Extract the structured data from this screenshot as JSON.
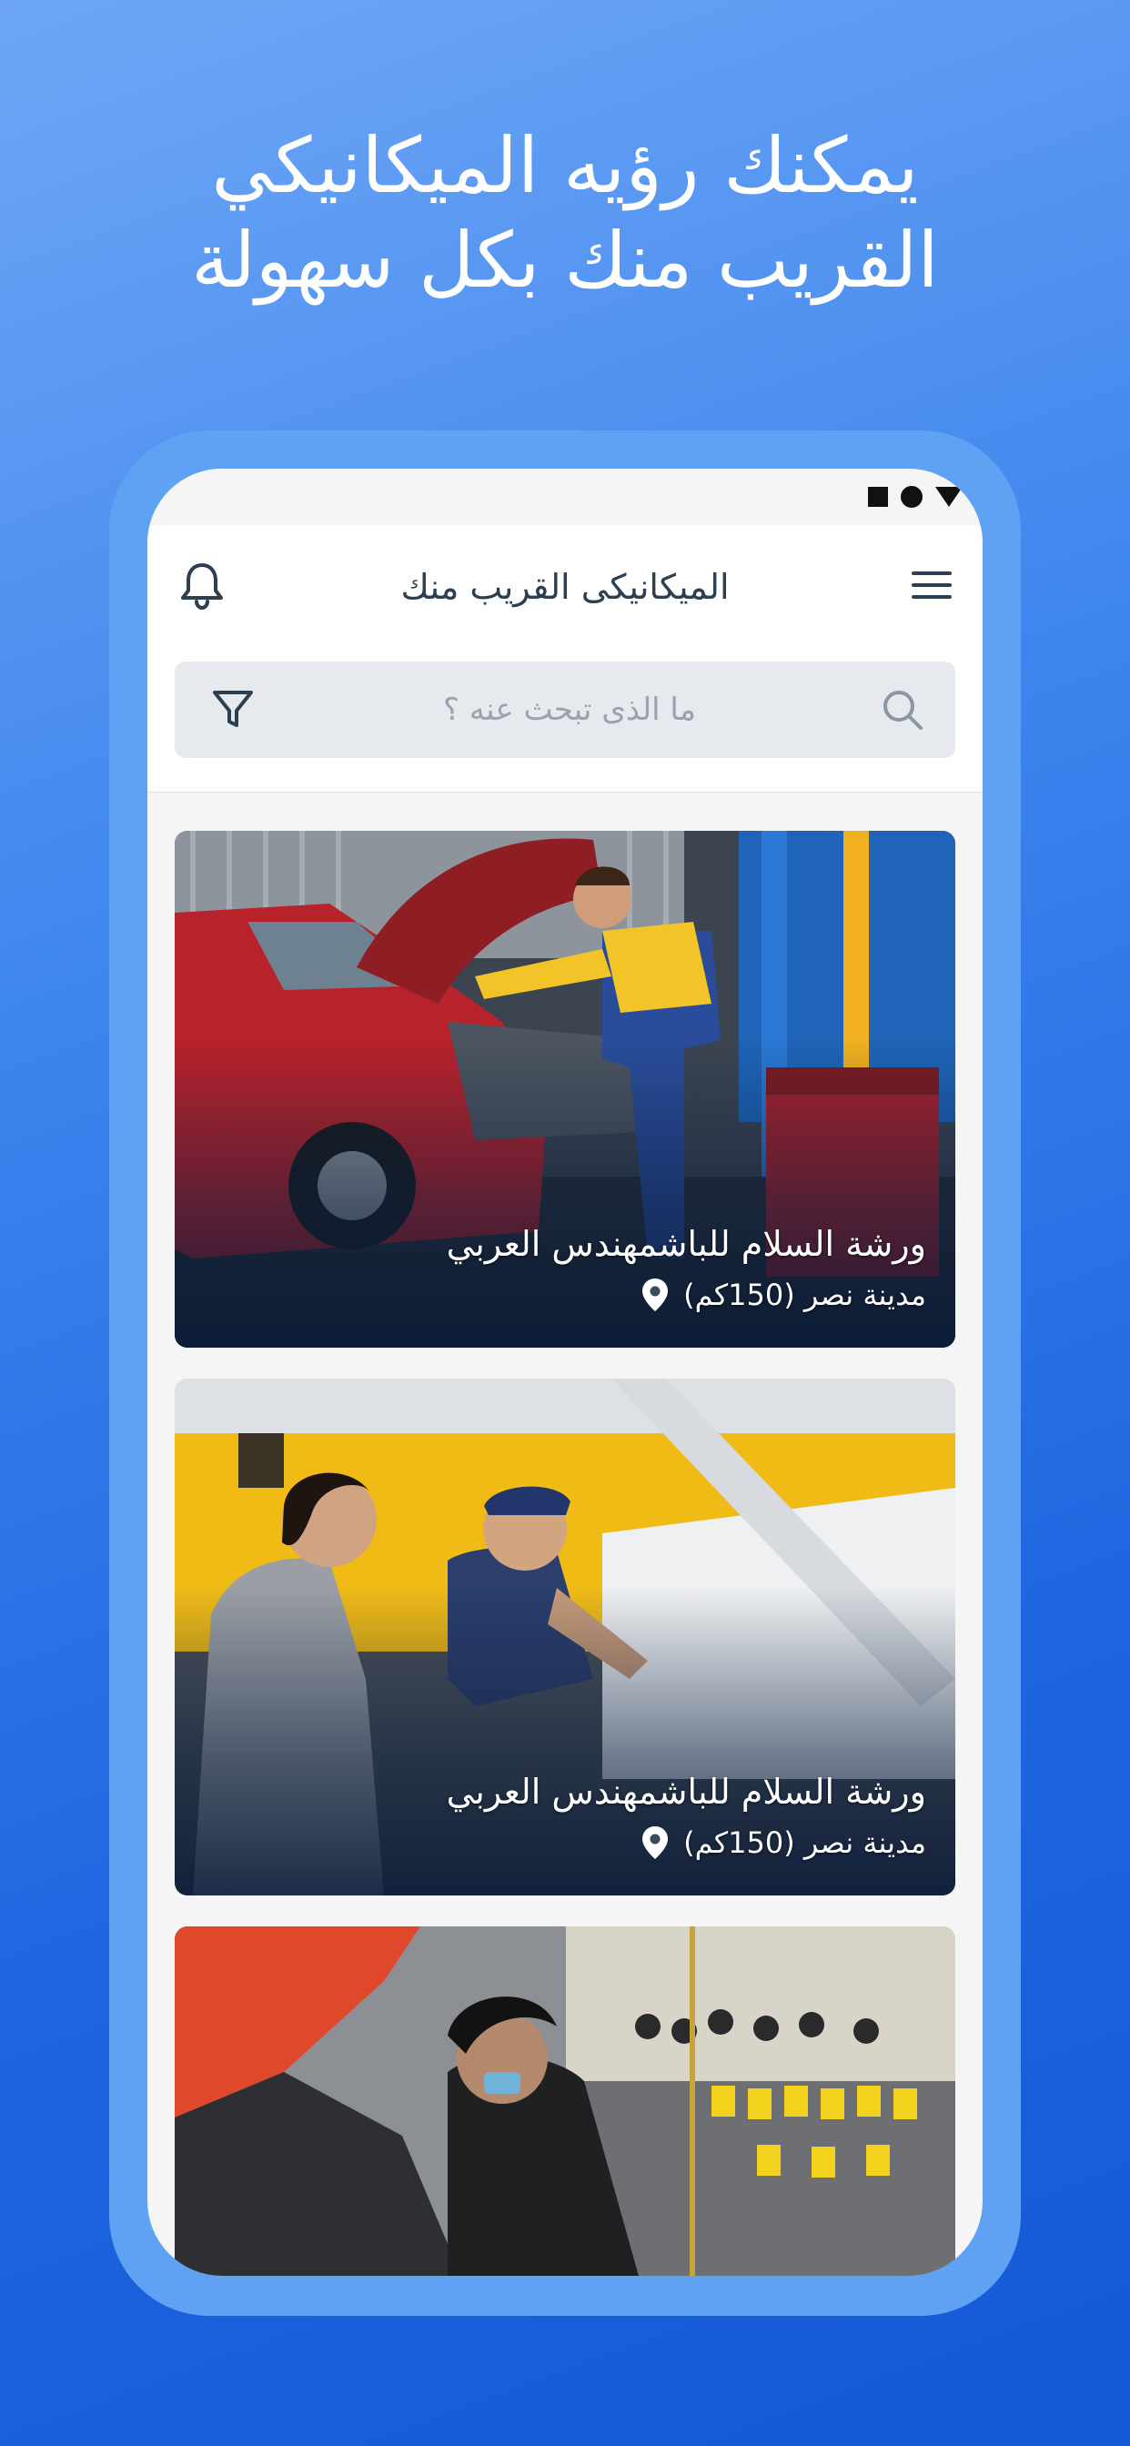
{
  "promo": {
    "line1": "يمكنك رؤيه الميكانيكي",
    "line2": "القريب منك بكل سهولة"
  },
  "status_bar": {
    "icons": [
      "square-icon",
      "circle-icon",
      "triangle-icon"
    ]
  },
  "app_bar": {
    "title": "الميكانيكى القريب منك",
    "left_icon": "bell-icon",
    "right_icon": "menu-icon"
  },
  "search": {
    "placeholder": "ما الذى تبحث عنه ؟",
    "value": "",
    "icons": [
      "search-icon",
      "filter-icon"
    ]
  },
  "workshops": [
    {
      "name": "ورشة السلام للباشمهندس العربي",
      "location": "مدينة نصر (150كم)"
    },
    {
      "name": "ورشة السلام للباشمهندس العربي",
      "location": "مدينة نصر (150كم)"
    }
  ],
  "colors": {
    "background_top": "#6ea6f5",
    "background_bottom": "#1558d6",
    "frame": "#5fa2f3",
    "title_text": "#2d3e50",
    "search_bg": "#e6e9ed"
  }
}
